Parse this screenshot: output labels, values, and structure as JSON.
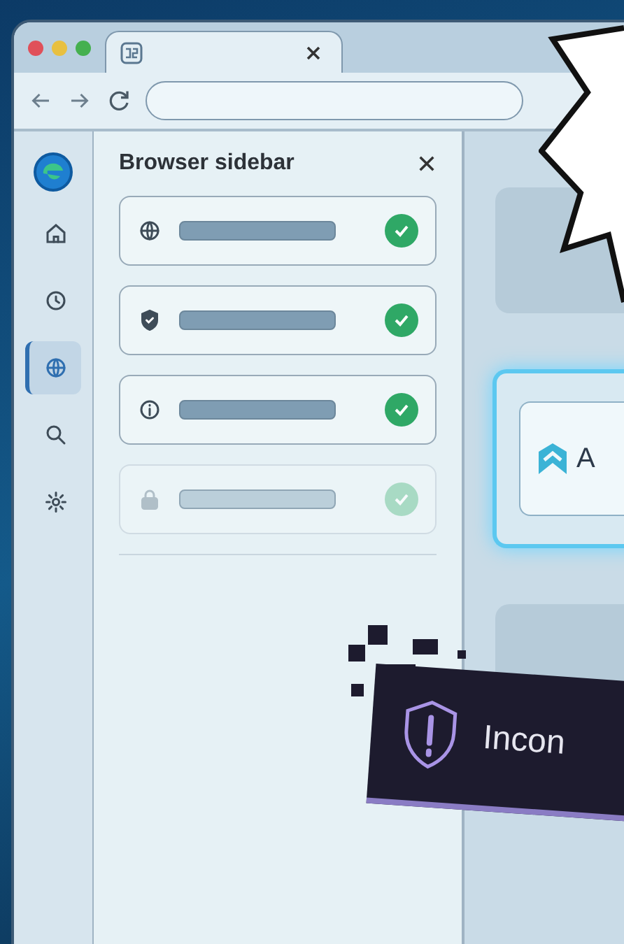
{
  "rail": {
    "items": [
      {
        "kind": "home",
        "selected": false
      },
      {
        "kind": "history",
        "selected": false
      },
      {
        "kind": "globe",
        "selected": true
      },
      {
        "kind": "search",
        "selected": false
      },
      {
        "kind": "settings",
        "selected": false
      }
    ]
  },
  "sidebar_panel": {
    "title": "Browser sidebar",
    "items": [
      {
        "kind": "globe",
        "checked": true,
        "disabled": false
      },
      {
        "kind": "shield",
        "checked": true,
        "disabled": false
      },
      {
        "kind": "info",
        "checked": true,
        "disabled": false
      },
      {
        "kind": "lock",
        "checked": true,
        "disabled": true
      }
    ]
  },
  "content": {
    "card_label": "A"
  },
  "alert": {
    "text": "Incon"
  }
}
